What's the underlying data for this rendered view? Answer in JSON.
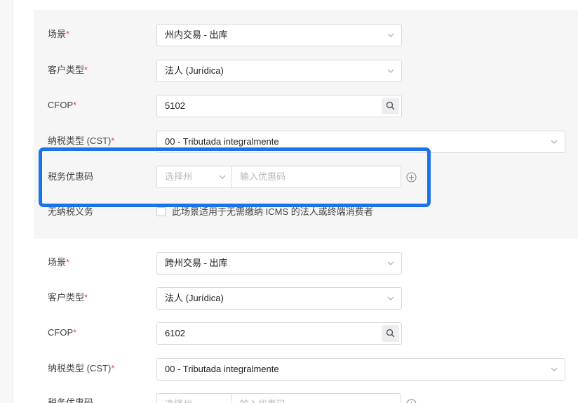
{
  "required_mark": "*",
  "block1": {
    "scenario": {
      "label": "场景",
      "value": "州内交易 - 出库"
    },
    "customer_type": {
      "label": "客户类型",
      "value": "法人 (Jurídica)"
    },
    "cfop": {
      "label": "CFOP",
      "value": "5102"
    },
    "cst": {
      "label": "纳税类型 (CST)",
      "value": "00 - Tributada integralmente"
    },
    "tax_benefit": {
      "label": "税务优惠码",
      "state_placeholder": "选择州",
      "code_placeholder": "输入优惠码"
    },
    "exempt": {
      "label": "无纳税义务",
      "checkbox_text": "此场景适用于无需缴纳 ICMS 的法人或终端消费者",
      "checked": false
    }
  },
  "block2": {
    "scenario": {
      "label": "场景",
      "value": "跨州交易 - 出库"
    },
    "customer_type": {
      "label": "客户类型",
      "value": "法人 (Jurídica)"
    },
    "cfop": {
      "label": "CFOP",
      "value": "6102"
    },
    "cst": {
      "label": "纳税类型 (CST)",
      "value": "00 - Tributada integralmente"
    },
    "tax_benefit": {
      "label": "税务优惠码",
      "state_placeholder": "选择州",
      "code_placeholder": "输入优惠码"
    }
  },
  "colors": {
    "highlight": "#1a73e8",
    "required": "#e5484d",
    "panel": "#f6f6f7"
  },
  "icons": {
    "dropdown": "chevron-down-icon",
    "search": "search-icon",
    "add": "plus-circle-icon"
  }
}
